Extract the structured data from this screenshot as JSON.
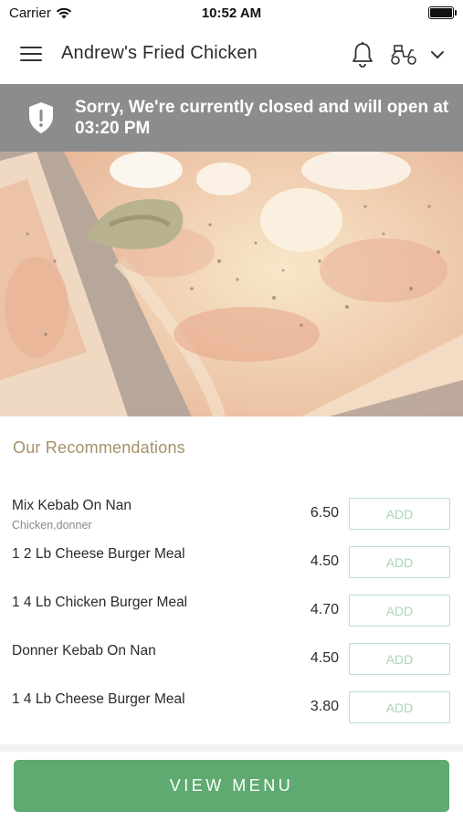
{
  "status_bar": {
    "carrier": "Carrier",
    "time": "10:52 AM"
  },
  "header": {
    "title": "Andrew's Fried Chicken",
    "icons": [
      "menu-icon",
      "bell-icon",
      "delivery-scooter-icon",
      "chevron-down-icon"
    ]
  },
  "banner": {
    "message": "Sorry, We're currently closed and will open at 03:20 PM",
    "icon": "shield-alert-icon",
    "background": "#8c8c8c"
  },
  "hero": {
    "image": "pizza-slices-photo"
  },
  "recommendations": {
    "title": "Our Recommendations",
    "items": [
      {
        "name": "Mix Kebab On Nan",
        "subtitle": "Chicken,donner",
        "price": "6.50",
        "button": "ADD"
      },
      {
        "name": "1 2 Lb Cheese Burger Meal",
        "subtitle": "",
        "price": "4.50",
        "button": "ADD"
      },
      {
        "name": "1 4 Lb Chicken Burger Meal",
        "subtitle": "",
        "price": "4.70",
        "button": "ADD"
      },
      {
        "name": "Donner Kebab On Nan",
        "subtitle": "",
        "price": "4.50",
        "button": "ADD"
      },
      {
        "name": "1 4 Lb Cheese Burger Meal",
        "subtitle": "",
        "price": "3.80",
        "button": "ADD"
      }
    ]
  },
  "footer": {
    "view_menu_label": "VIEW MENU",
    "accent": "#5faa71"
  }
}
